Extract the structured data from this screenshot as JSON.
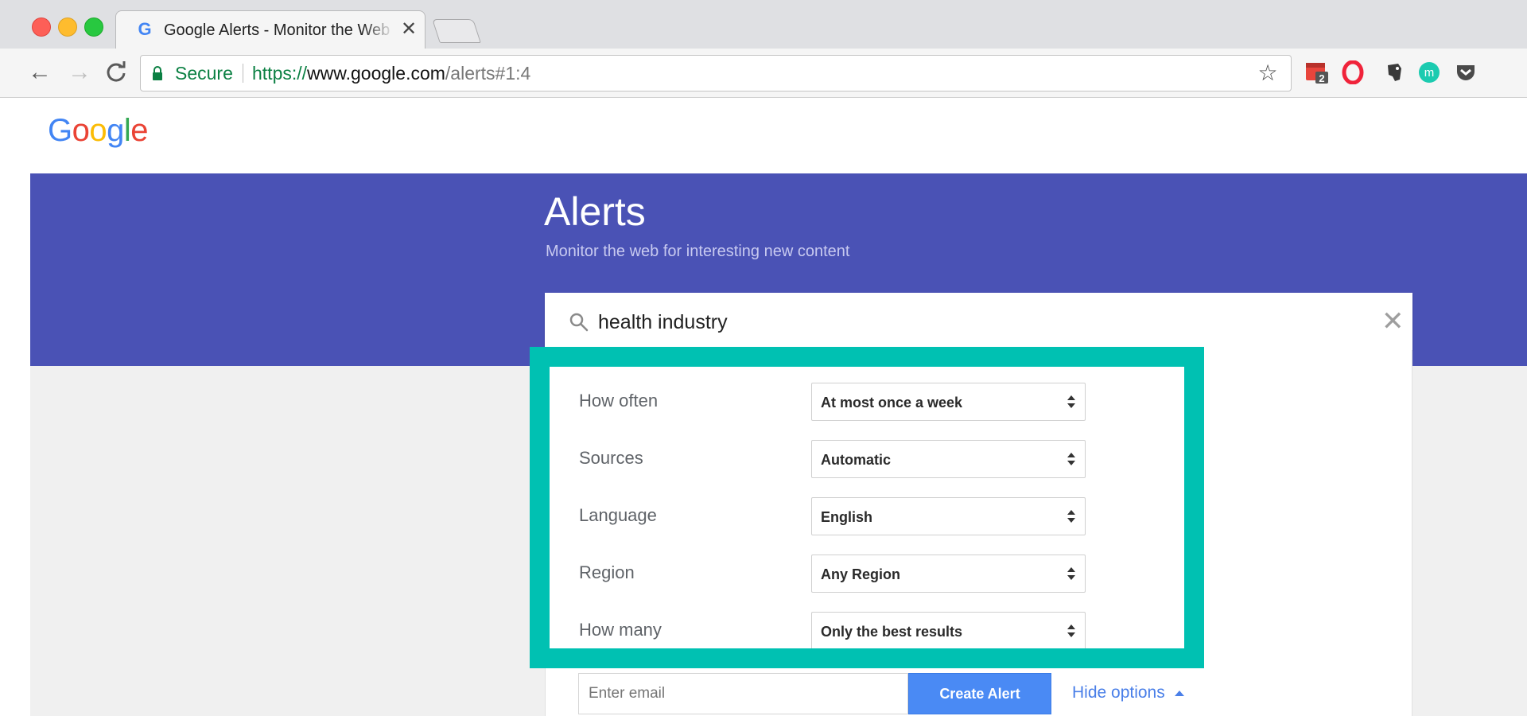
{
  "browser": {
    "tab": {
      "title": "Google Alerts - Monitor the Web for interesting new content",
      "favicon": "google-g-icon"
    },
    "address_bar": {
      "security_label": "Secure",
      "url_protocol": "https://",
      "url_host": "www.google.com",
      "url_path": "/alerts#1:4"
    },
    "extensions": [
      "calendar-extension-icon",
      "opera-extension-icon",
      "evernote-extension-icon",
      "m-extension-icon",
      "pocket-extension-icon"
    ],
    "extension_badge": "2"
  },
  "logo": {
    "text": "Google"
  },
  "header": {
    "title": "Alerts",
    "subtitle": "Monitor the web for interesting new content"
  },
  "search": {
    "value": "health industry"
  },
  "options": [
    {
      "label": "How often",
      "value": "At most once a week"
    },
    {
      "label": "Sources",
      "value": "Automatic"
    },
    {
      "label": "Language",
      "value": "English"
    },
    {
      "label": "Region",
      "value": "Any Region"
    },
    {
      "label": "How many",
      "value": "Only the best results"
    }
  ],
  "footer": {
    "email_placeholder": "Enter email",
    "create_label": "Create Alert",
    "hide_options_label": "Hide options"
  },
  "colors": {
    "hero": "#4a52b5",
    "highlight": "#00c1b2",
    "create_button": "#4a8af4",
    "link": "#4a7fe8",
    "secure": "#0b8043"
  }
}
